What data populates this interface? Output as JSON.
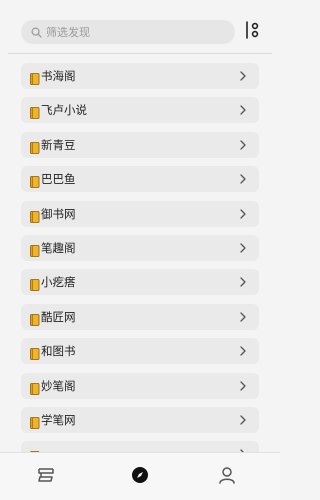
{
  "search": {
    "placeholder": "筛选发现"
  },
  "icons": {
    "search": "search-icon",
    "filter": "filter-icon",
    "book": "book-icon",
    "chevron": "chevron-right-icon",
    "tab_shelf": "bookshelf-icon",
    "tab_discover": "compass-icon",
    "tab_profile": "user-icon"
  },
  "sources": [
    {
      "label": "书海阁"
    },
    {
      "label": "飞卢小说"
    },
    {
      "label": "新青豆"
    },
    {
      "label": "巴巴鱼"
    },
    {
      "label": "御书网"
    },
    {
      "label": "笔趣阁"
    },
    {
      "label": "小疙瘩"
    },
    {
      "label": "酷匠网"
    },
    {
      "label": "和图书"
    },
    {
      "label": "妙笔阁"
    },
    {
      "label": "学笔网"
    },
    {
      "label": ""
    }
  ],
  "colors": {
    "book": "#f0b429",
    "book_dark": "#8a5a00",
    "active_tab": "#111111",
    "inactive_tab": "#555555"
  }
}
